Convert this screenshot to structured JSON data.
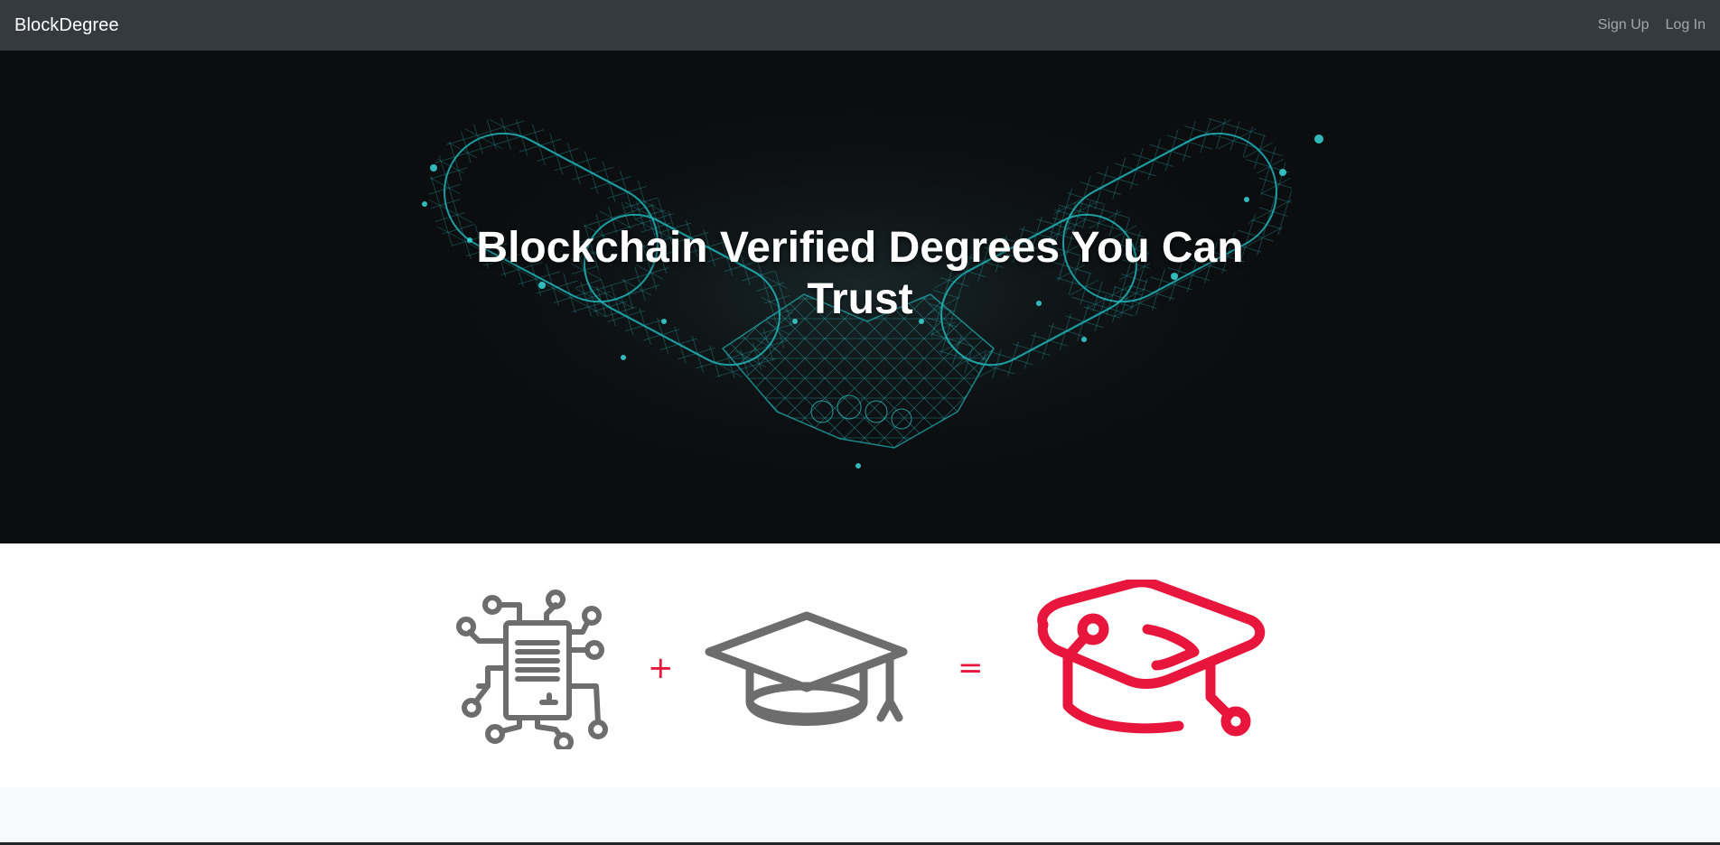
{
  "navbar": {
    "brand": "BlockDegree",
    "links": [
      "Sign Up",
      "Log In"
    ]
  },
  "hero": {
    "title": "Blockchain Verified Degrees You Can Trust",
    "image": "glowing-chain-handshake-illustration"
  },
  "equation": {
    "items": [
      {
        "icon": "circuit-document-icon",
        "color": "#6d6d6d"
      },
      {
        "operator": "+"
      },
      {
        "icon": "graduation-cap-icon",
        "color": "#6d6d6d"
      },
      {
        "operator": "="
      },
      {
        "icon": "blockchain-graduation-cap-icon",
        "color": "#e8163c"
      }
    ]
  },
  "colors": {
    "navbar_bg": "#343a40",
    "hero_bg": "#0b0d0f",
    "hero_glow": "#1fb5b8",
    "accent": "#e8163c",
    "icon_gray": "#6d6d6d"
  }
}
